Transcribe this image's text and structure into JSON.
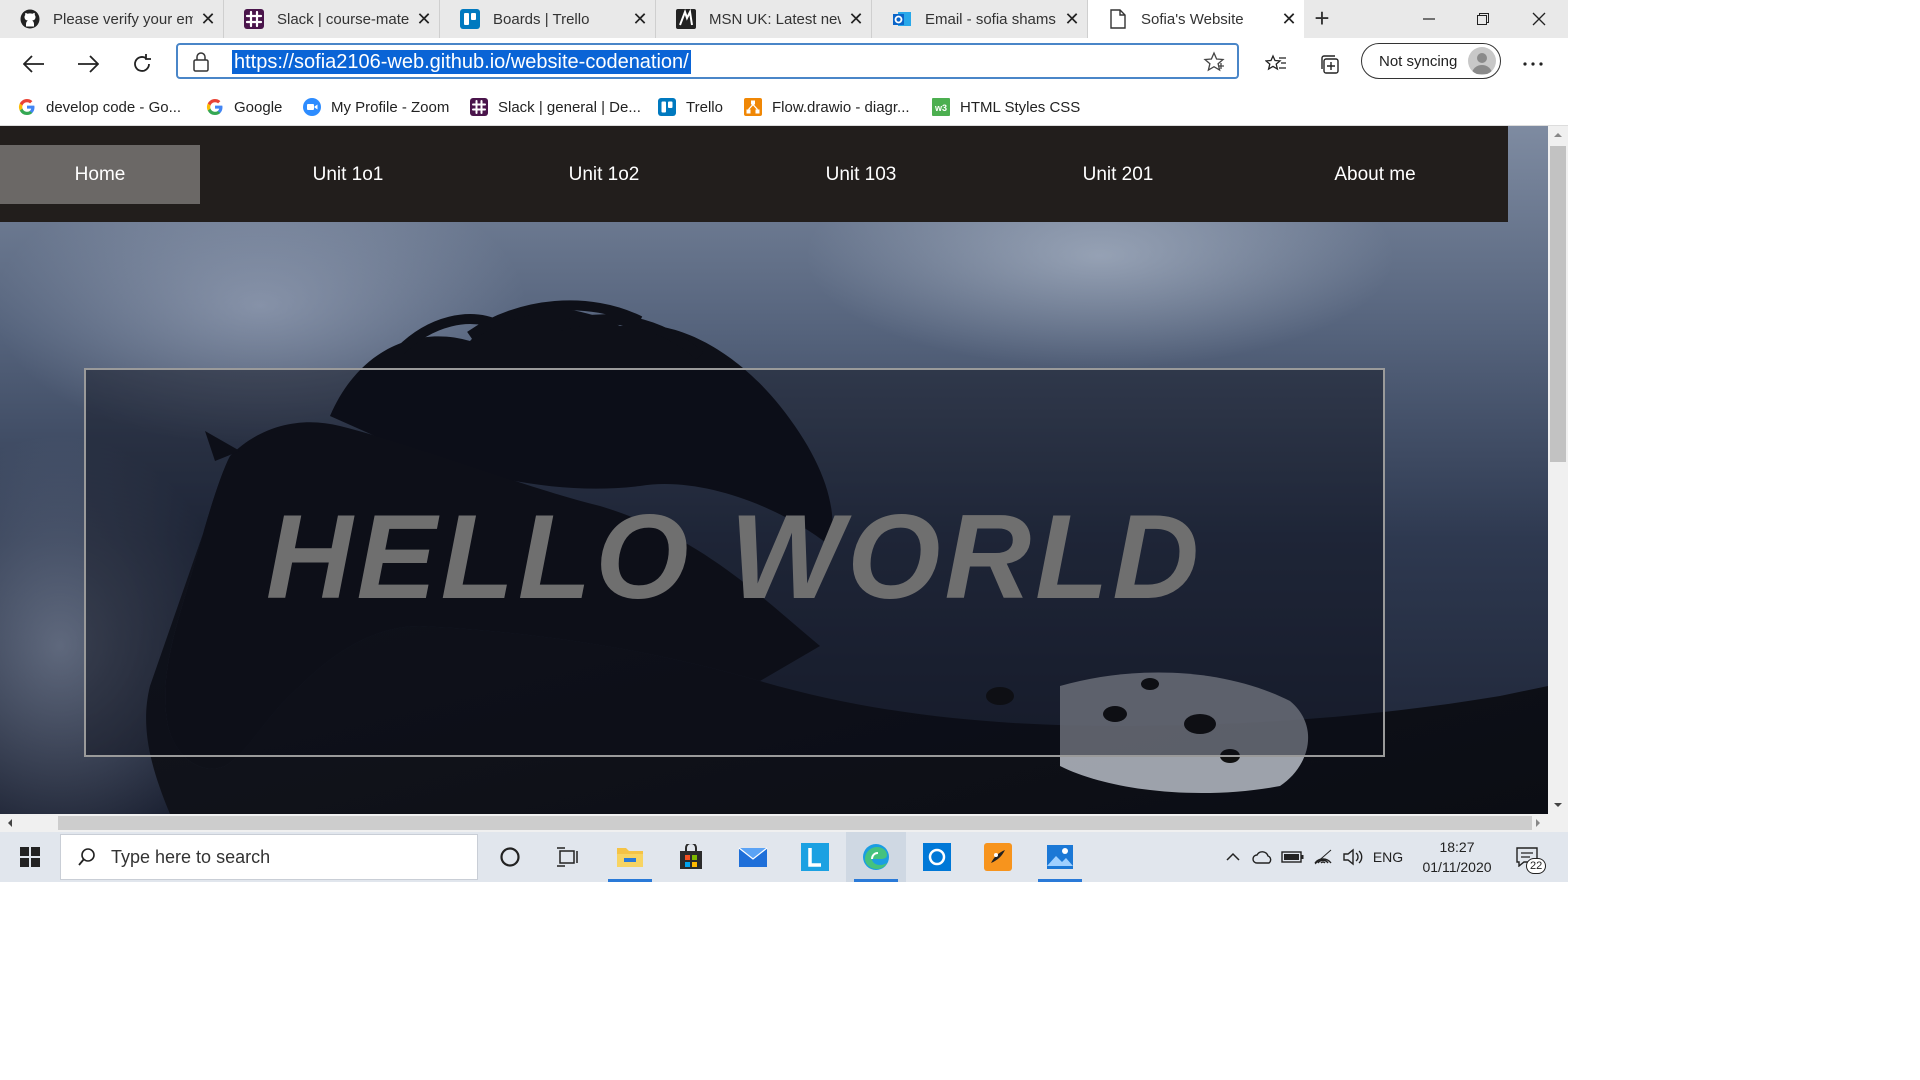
{
  "browser": {
    "tabs": [
      {
        "title": "Please verify your em",
        "icon": "github-icon"
      },
      {
        "title": "Slack | course-materi",
        "icon": "slack-icon"
      },
      {
        "title": "Boards | Trello",
        "icon": "trello-icon"
      },
      {
        "title": "MSN UK: Latest news",
        "icon": "msn-icon"
      },
      {
        "title": "Email - sofia shams -",
        "icon": "outlook-icon"
      },
      {
        "title": "Sofia's Website",
        "icon": "page-icon",
        "active": true
      }
    ],
    "new_tab_glyph": "+",
    "address_url": "https://sofia2106-web.github.io/website-codenation/",
    "sync_label": "Not syncing",
    "bookmarks": [
      {
        "label": "develop code - Go...",
        "icon": "google-icon"
      },
      {
        "label": "Google",
        "icon": "google-icon"
      },
      {
        "label": "My Profile - Zoom",
        "icon": "zoom-icon"
      },
      {
        "label": "Slack | general | De...",
        "icon": "slack-icon"
      },
      {
        "label": "Trello",
        "icon": "trello-icon"
      },
      {
        "label": "Flow.drawio - diagr...",
        "icon": "drawio-icon"
      },
      {
        "label": "HTML Styles CSS",
        "icon": "w3schools-icon"
      }
    ]
  },
  "page": {
    "nav": [
      "Home",
      "Unit 1o1",
      "Unit 1o2",
      "Unit 103",
      "Unit 201",
      "About me"
    ],
    "active_nav": "Home",
    "hero_text": "HELLO WORLD"
  },
  "taskbar": {
    "search_placeholder": "Type here to search",
    "language": "ENG",
    "time": "18:27",
    "date": "01/11/2020",
    "notifications_count": "22"
  },
  "colors": {
    "nav_background": "#221e1c",
    "nav_active": "#6b6866",
    "hero_text": "#6f6f6f",
    "url_highlight": "#0a64d6",
    "taskbar": "#e1e6ed"
  }
}
